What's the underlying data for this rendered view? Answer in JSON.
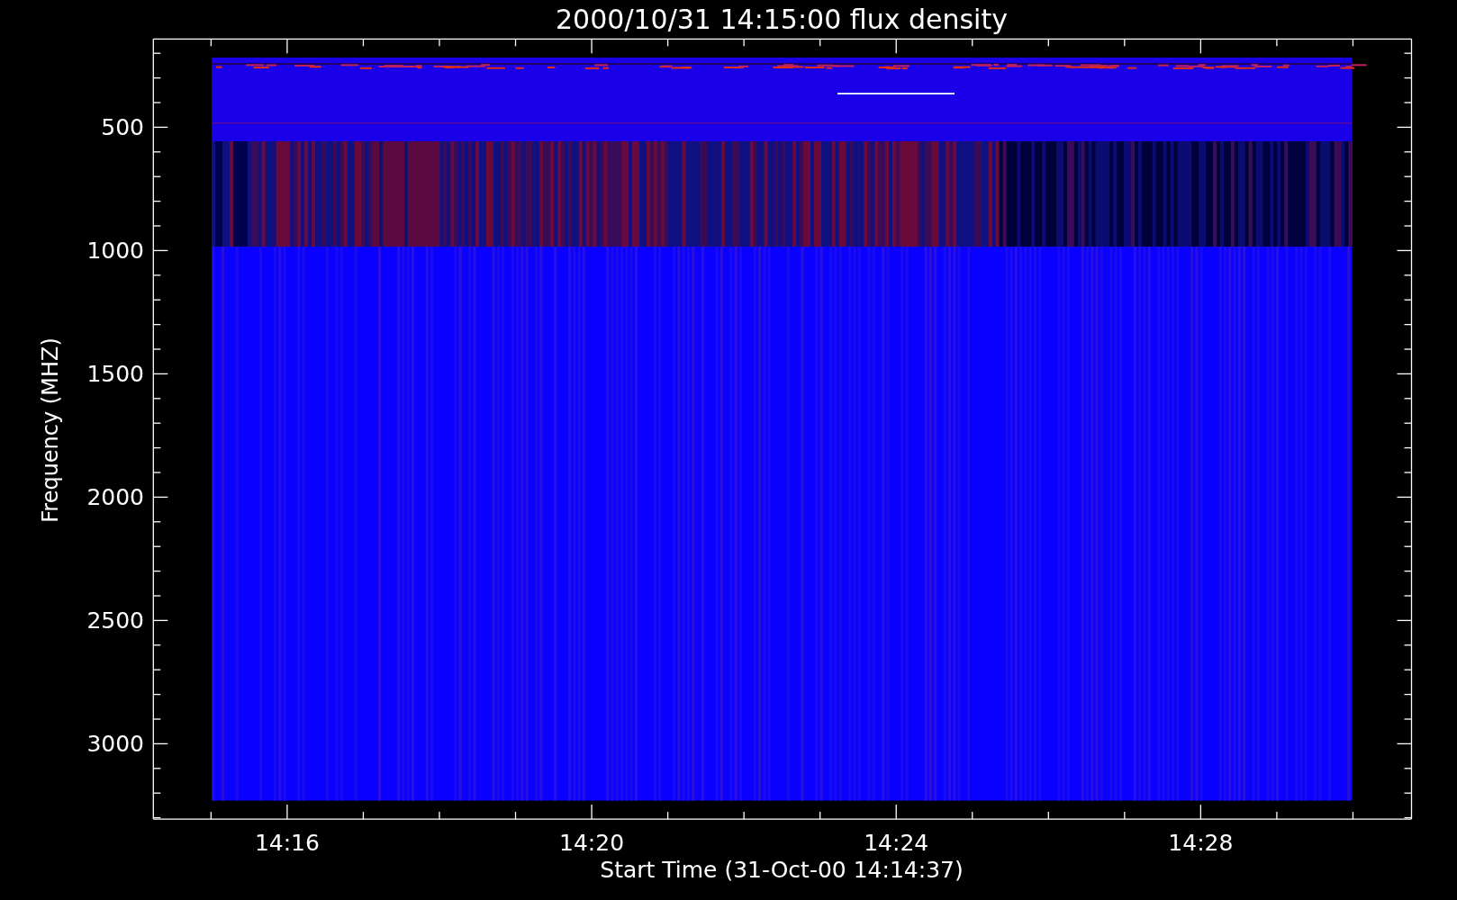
{
  "plot": {
    "title": "2000/10/31 14:15:00 flux density",
    "xlabel": "Start Time (31-Oct-00 14:14:37)",
    "ylabel": "Frequency (MHZ)",
    "x_tick_labels": [
      "14:16",
      "14:20",
      "14:24",
      "14:28"
    ],
    "y_tick_labels": [
      "500",
      "1000",
      "1500",
      "2000",
      "2500",
      "3000"
    ]
  }
}
